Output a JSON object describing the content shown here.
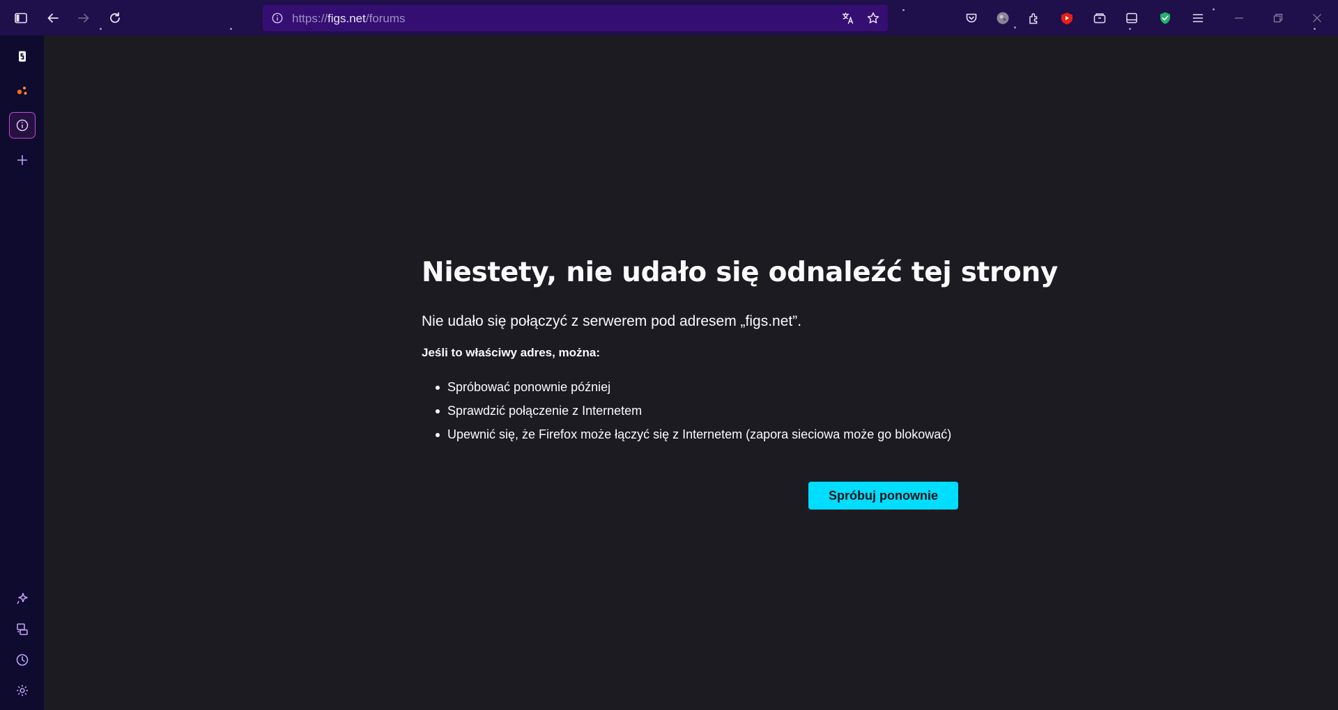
{
  "toolbar": {
    "url": {
      "scheme": "https://",
      "host": "figs.net",
      "path": "/forums"
    }
  },
  "error_page": {
    "title": "Niestety, nie udało się odnaleźć tej strony",
    "description": "Nie udało się połączyć z serwerem pod adresem „figs.net”.",
    "lead": "Jeśli to właściwy adres, można:",
    "suggestions": [
      "Spróbować ponownie później",
      "Sprawdzić połączenie z Internetem",
      "Upewnić się, że Firefox może łączyć się z Internetem (zapora sieciowa może go blokować)"
    ],
    "retry_label": "Spróbuj ponownie"
  },
  "icons": {
    "toolbar": [
      "sidebar-toggle-icon",
      "back-arrow-icon",
      "forward-arrow-icon",
      "reload-icon",
      "site-info-icon",
      "translate-icon",
      "bookmark-star-icon",
      "pocket-icon",
      "profile-avatar-icon",
      "extensions-icon",
      "youtube-icon",
      "containers-icon",
      "tab-overview-icon",
      "shield-check-icon",
      "menu-icon",
      "minimize-icon",
      "restore-icon",
      "close-icon"
    ],
    "sidebar": [
      "panel-g-icon",
      "dots-app-icon",
      "info-panel-icon",
      "add-panel-icon",
      "ai-sparkle-icon",
      "synced-devices-icon",
      "history-icon",
      "settings-gear-icon"
    ]
  },
  "colors": {
    "toolbar_bg": "#1f0f4a",
    "urlbar_bg": "#350e72",
    "sidebar_bg": "#0e0b2e",
    "content_bg": "#1c1b22",
    "accent_button": "#00ddff",
    "sidebar_active_border": "#c24bd8"
  }
}
